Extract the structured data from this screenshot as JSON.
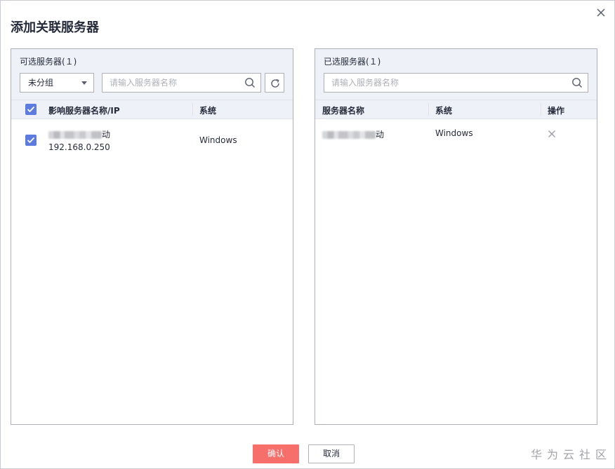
{
  "dialog": {
    "title": "添加关联服务器",
    "close_icon": "close-icon"
  },
  "left_panel": {
    "title": "可选服务器(１)",
    "group_select": {
      "value": "未分组",
      "icon": "caret-down-icon"
    },
    "search": {
      "placeholder": "请输入服务器名称",
      "icon": "search-icon"
    },
    "refresh_icon": "refresh-icon",
    "columns": [
      "影响服务器名称/IP",
      "系统"
    ],
    "select_all_checked": true,
    "rows": [
      {
        "checked": true,
        "name_suffix": "动",
        "ip": "192.168.0.250",
        "os": "Windows"
      }
    ]
  },
  "right_panel": {
    "title": "已选服务器(１)",
    "search": {
      "placeholder": "请输入服务器名称",
      "icon": "search-icon"
    },
    "columns": [
      "服务器名称",
      "系统",
      "操作"
    ],
    "rows": [
      {
        "name_suffix": "动",
        "os": "Windows",
        "action_icon": "close-icon"
      }
    ]
  },
  "footer": {
    "ok_label": "确认",
    "cancel_label": "取消"
  },
  "watermark": "华为云社区",
  "colors": {
    "accent": "#5e7ce0",
    "primary_button": "#f66f6a",
    "header_bg": "#eef2f8",
    "border": "#adb0b8"
  }
}
